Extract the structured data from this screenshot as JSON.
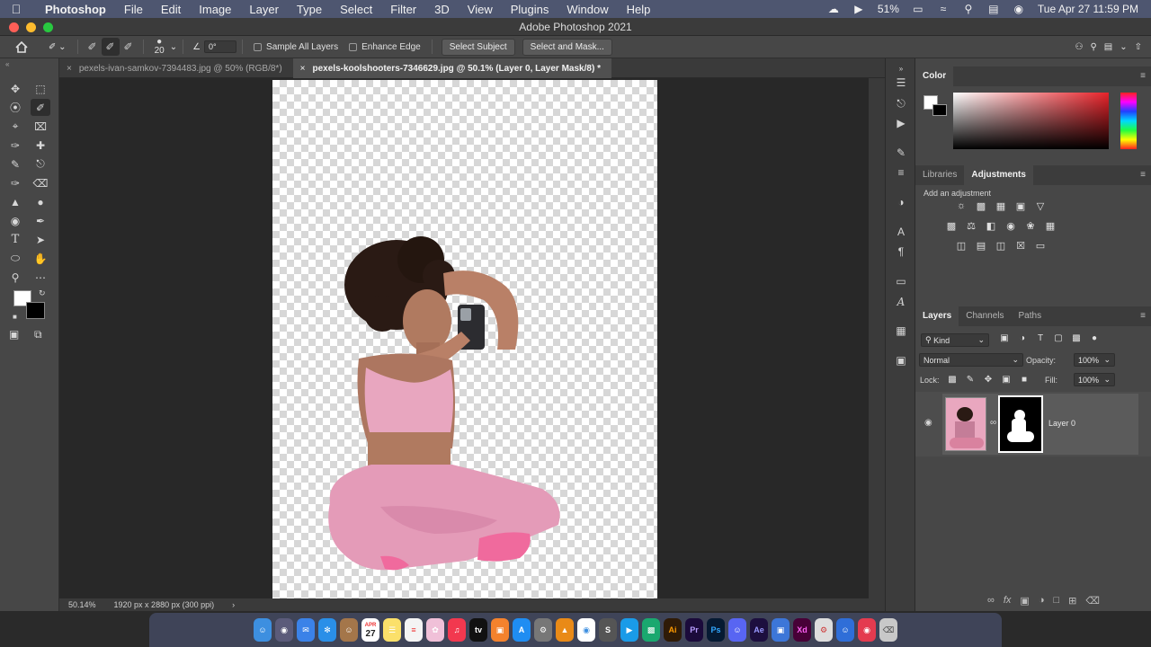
{
  "menubar": {
    "apple": "",
    "app_name": "Photoshop",
    "items": [
      "File",
      "Edit",
      "Image",
      "Layer",
      "Type",
      "Select",
      "Filter",
      "3D",
      "View",
      "Plugins",
      "Window",
      "Help"
    ],
    "battery": "51%",
    "datetime": "Tue Apr 27  11:59 PM"
  },
  "window": {
    "title": "Adobe Photoshop 2021"
  },
  "options": {
    "brush_size": "20",
    "angle": "0°",
    "sample_all_layers": "Sample All Layers",
    "enhance_edge": "Enhance Edge",
    "select_subject": "Select Subject",
    "select_and_mask": "Select and Mask..."
  },
  "tabs": [
    {
      "label": "pexels-ivan-samkov-7394483.jpg @ 50% (RGB/8*)",
      "active": false
    },
    {
      "label": "pexels-koolshooters-7346629.jpg @ 50.1% (Layer 0, Layer Mask/8) *",
      "active": true
    }
  ],
  "status": {
    "zoom": "50.14%",
    "doc_info": "1920 px x 2880 px (300 ppi)",
    "arrow": "›"
  },
  "color_panel": {
    "title": "Color"
  },
  "adjust_panel": {
    "tabs": [
      "Libraries",
      "Adjustments"
    ],
    "active": "Adjustments",
    "hint": "Add an adjustment"
  },
  "layers_panel": {
    "tabs": [
      "Layers",
      "Channels",
      "Paths"
    ],
    "active": "Layers",
    "filter": "Kind",
    "blend_mode": "Normal",
    "opacity_label": "Opacity:",
    "opacity": "100%",
    "lock_label": "Lock:",
    "fill_label": "Fill:",
    "fill": "100%",
    "layers": [
      {
        "name": "Layer 0",
        "visible": true,
        "has_mask": true
      }
    ]
  },
  "colors": {
    "accent": "#2d7bf6",
    "menubar": "#4e5670",
    "panel": "#474747",
    "workspace": "#282828"
  },
  "dock": {
    "calendar_month": "APR",
    "calendar_day": "27"
  }
}
